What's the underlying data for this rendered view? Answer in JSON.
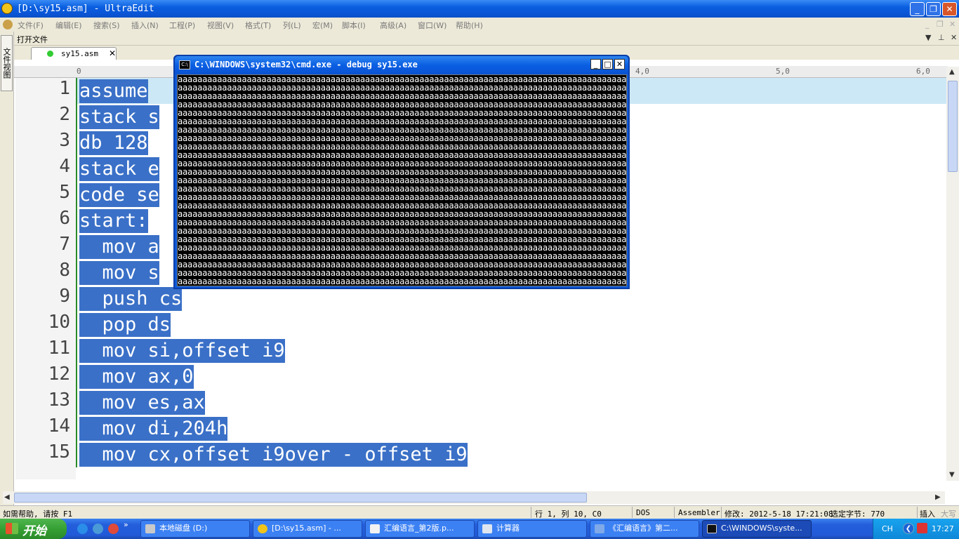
{
  "app": {
    "title": "[D:\\sy15.asm] - UltraEdit"
  },
  "menu": [
    "文件(F)",
    "编辑(E)",
    "搜索(S)",
    "插入(N)",
    "工程(P)",
    "视图(V)",
    "格式(T)",
    "列(L)",
    "宏(M)",
    "脚本(I)",
    "高级(A)",
    "窗口(W)",
    "帮助(H)"
  ],
  "panel": {
    "title": "打开文件",
    "side_tab": "文件视图"
  },
  "tab": {
    "label": "sy15.asm"
  },
  "ruler": [
    "0",
    "4,0",
    "5,0",
    "6,0"
  ],
  "editor": {
    "line_numbers": [
      "1",
      "2",
      "3",
      "4",
      "5",
      "6",
      "7",
      "8",
      "9",
      "10",
      "11",
      "12",
      "13",
      "14",
      "15"
    ],
    "lines": [
      "assume",
      "stack s",
      "db 128",
      "stack e",
      "code se",
      "start:",
      "  mov a",
      "  mov s",
      "  push cs",
      "  pop ds",
      "  mov si,offset i9",
      "  mov ax,0",
      "  mov es,ax",
      "  mov di,204h",
      "  mov cx,offset i9over - offset i9"
    ]
  },
  "cmd": {
    "title": "C:\\WINDOWS\\system32\\cmd.exe - debug sy15.exe",
    "icon_label": "C:\\",
    "row_text": "aaaaaaaaaaaaaaaaaaaaaaaaaaaaaaaaaaaaaaaaaaaaaaaaaaaaaaaaaaaaaaaaaaaaaaaaaaaaaaaaaaaaaaaaaaaaaaaaaaaaaaaaaaaaaaaaaaaaaaaaaaaaaaaaaaaaaaaaaaaaaaaaaaaaaaaaaaaaaaaaaaaaaaaaa",
    "rows": 25
  },
  "status": {
    "help": "如需帮助, 请按 F1",
    "pos": "行 1, 列 10, C0",
    "format": "DOS",
    "lang": "Assembler",
    "modified": "修改: 2012-5-18 17:21:08",
    "selected": "选定字节: 770",
    "mode": "插入",
    "caps": "大写"
  },
  "taskbar": {
    "start": "开始",
    "items": [
      {
        "label": "本地磁盘 (D:)"
      },
      {
        "label": "[D:\\sy15.asm] - ..."
      },
      {
        "label": "汇编语言_第2版.p..."
      },
      {
        "label": "计算器"
      },
      {
        "label": "《汇编语言》第二..."
      },
      {
        "label": "C:\\WINDOWS\\syste..."
      }
    ],
    "lang": "CH",
    "clock": "17:27"
  },
  "colors": {
    "selection": "#3a70c7",
    "current_line": "#cce8f6",
    "titlebar": "#0a5fe0",
    "taskbar": "#245edb",
    "start": "#35a034"
  }
}
